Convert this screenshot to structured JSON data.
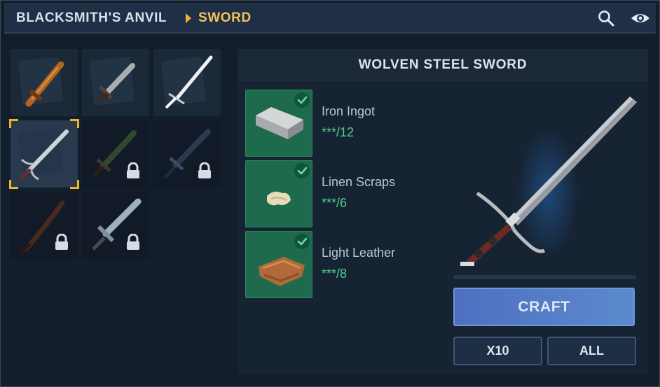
{
  "header": {
    "location": "BLACKSMITH'S ANVIL",
    "current": "SWORD",
    "icons": [
      "search-icon",
      "eye-icon"
    ]
  },
  "recipes": [
    {
      "name": "wooden-sword",
      "locked": false,
      "selected": false
    },
    {
      "name": "bronze-sword",
      "locked": false,
      "selected": false
    },
    {
      "name": "white-blade",
      "locked": false,
      "selected": false
    },
    {
      "name": "wolven-steel-sword",
      "locked": false,
      "selected": true
    },
    {
      "name": "dark-green-sword",
      "locked": true,
      "selected": false
    },
    {
      "name": "dark-blue-sword",
      "locked": true,
      "selected": false
    },
    {
      "name": "curved-sword",
      "locked": true,
      "selected": false
    },
    {
      "name": "crystal-sword",
      "locked": true,
      "selected": false
    }
  ],
  "detail": {
    "title": "WOLVEN STEEL SWORD",
    "materials": [
      {
        "name": "Iron Ingot",
        "qty": "***/12",
        "icon": "iron-ingot-icon"
      },
      {
        "name": "Linen Scraps",
        "qty": "***/6",
        "icon": "linen-scraps-icon"
      },
      {
        "name": "Light Leather",
        "qty": "***/8",
        "icon": "light-leather-icon"
      }
    ],
    "progress": 0,
    "craft_label": "CRAFT",
    "x10_label": "X10",
    "all_label": "ALL"
  },
  "colors": {
    "accent": "#f0b429",
    "material_bg": "#1d6b4c",
    "craft_button": "#5577c4",
    "quantity": "#4fd08a"
  }
}
